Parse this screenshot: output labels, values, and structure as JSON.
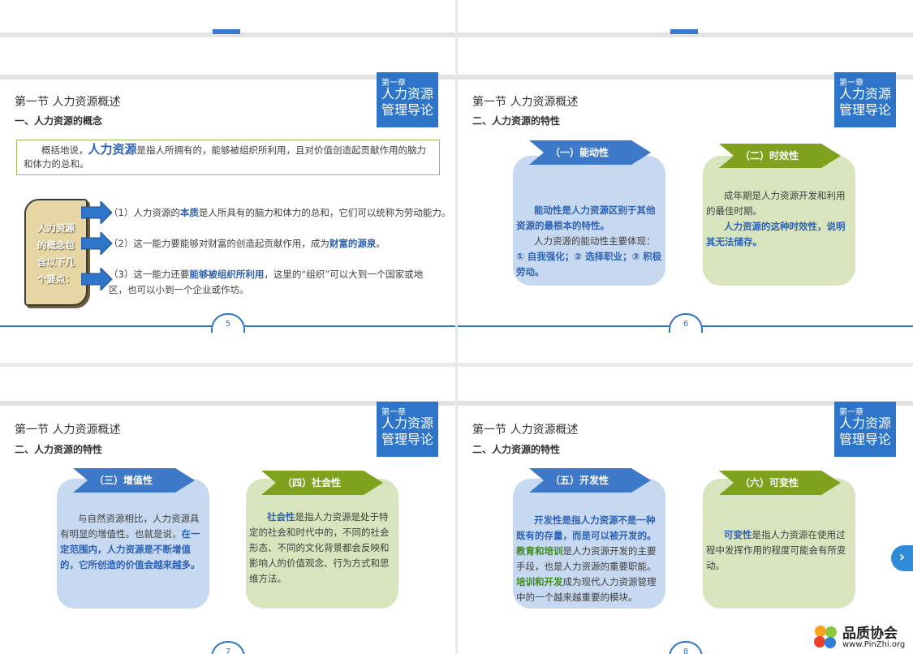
{
  "slides": {
    "s5": {
      "section": "第一节  人力资源概述",
      "sub": "一、人力资源的概念",
      "chap_small": "第一章",
      "chap_big1": "人力资源",
      "chap_big2": "管理导论",
      "def_pre": "概括地说，",
      "def_key": "人力资源",
      "def_post": "是指人所拥有的，能够被组织所利用，且对价值创造起贡献作用的脑力和体力的总和。",
      "scroll_l1": "人力资源",
      "scroll_l2": "的概念包",
      "scroll_l3": "含以下几",
      "scroll_l4": "个要点：",
      "p1_pre": "（1）人力资源的",
      "p1_key": "本质",
      "p1_post": "是人所具有的脑力和体力的总和，它们可以统称为劳动能力。",
      "p2_pre": "（2）这一能力要能够对财富的创造起贡献作用，成为",
      "p2_key": "财富的源泉",
      "p2_post": "。",
      "p3_pre": "（3）这一能力还要",
      "p3_key": "能够被组织所利用",
      "p3_post": "，这里的“组织”可以大到一个国家或地区，也可以小到一个企业或作坊。",
      "page": "5"
    },
    "s6": {
      "section": "第一节  人力资源概述",
      "sub": "二、人力资源的特性",
      "chap_small": "第一章",
      "chap_big1": "人力资源",
      "chap_big2": "管理导论",
      "b1": "（一）能动性",
      "c1_k1": "能动性是人力资源区别于其他资源的最根本的特性。",
      "c1_t1": "人力资源的能动性主要体现：",
      "c1_k2": "① 自我强化；② 选择职业；③ 积极劳动。",
      "b2": "（二）时效性",
      "c2_t1": "成年期是人力资源开发和利用的最佳时期。",
      "c2_k1": "人力资源的这种时效性，说明其无法储存。",
      "page": "6"
    },
    "s7": {
      "section": "第一节  人力资源概述",
      "sub": "二、人力资源的特性",
      "chap_small": "第一章",
      "chap_big1": "人力资源",
      "chap_big2": "管理导论",
      "b1": "（三）增值性",
      "c1_t1": "与自然资源相比，人力资源具有明显的增值性。也就是说，",
      "c1_k1": "在一定范围内，人力资源是不断增值的，它所创造的价值会越来越多。",
      "b2": "（四）社会性",
      "c2_k1": "社会性",
      "c2_t1": "是指人力资源是处于特定的社会和时代中的，不同的社会形态、不同的文化背景都会反映和影响人的价值观念、行为方式和思维方法。",
      "page": "7"
    },
    "s8": {
      "section": "第一节  人力资源概述",
      "sub": "二、人力资源的特性",
      "chap_small": "第一章",
      "chap_big1": "人力资源",
      "chap_big2": "管理导论",
      "b1": "（五）开发性",
      "c1_k1": "开发性是指人力资源不是一种既有的存量，而是可以被开发的。",
      "c1_g1": "教育和培训",
      "c1_t1": "是人力资源开发的主要手段，也是人力资源的重要职能。",
      "c1_g2": "培训和开发",
      "c1_t2": "成为现代人力资源管理中的一个越来越重要的模块。",
      "b2": "（六）可变性",
      "c2_k1": "可变性",
      "c2_t1": "是指人力资源在使用过程中发挥作用的程度可能会有所变动。",
      "page": "8"
    }
  },
  "logo": {
    "name": "品质协会",
    "url": "www.PinZhi.org"
  },
  "colors": {
    "accent": "#2e74c8",
    "green": "#7ea21d",
    "card_blue": "#c6d9f1",
    "card_green": "#d7e4bd"
  },
  "icons": {
    "next": "chevron-right-icon",
    "logo": "pinwheel-logo-icon"
  }
}
